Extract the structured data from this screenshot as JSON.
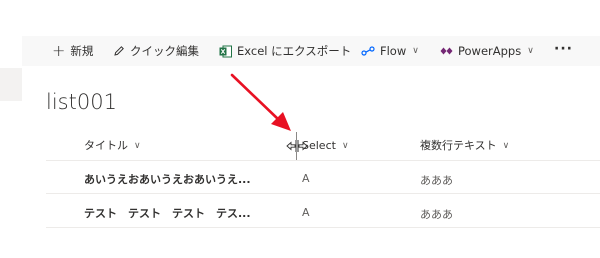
{
  "command_bar": {
    "new_label": "新規",
    "quick_edit_label": "クイック編集",
    "export_label": "Excel にエクスポート",
    "flow_label": "Flow",
    "powerapps_label": "PowerApps",
    "more_label": "···"
  },
  "list": {
    "title": "list001",
    "columns": [
      {
        "label": "タイトル"
      },
      {
        "label": "Select"
      },
      {
        "label": "複数行テキスト"
      }
    ],
    "rows": [
      {
        "title": "あいうえおあいうえおあいうえ...",
        "select": "A",
        "multiline": "あああ"
      },
      {
        "title": "テスト　テスト　テスト　テス...",
        "select": "A",
        "multiline": "あああ"
      }
    ]
  },
  "colors": {
    "command_bar_bg": "#f8f8f8",
    "excel_green": "#217346",
    "flow_blue": "#0066ff",
    "powerapps_purple": "#742774",
    "annotation_red": "#e81123"
  },
  "icons": [
    "plus-icon",
    "pencil-icon",
    "excel-icon",
    "flow-icon",
    "powerapps-icon",
    "chevron-down-icon",
    "more-icon",
    "column-resize-icon"
  ]
}
